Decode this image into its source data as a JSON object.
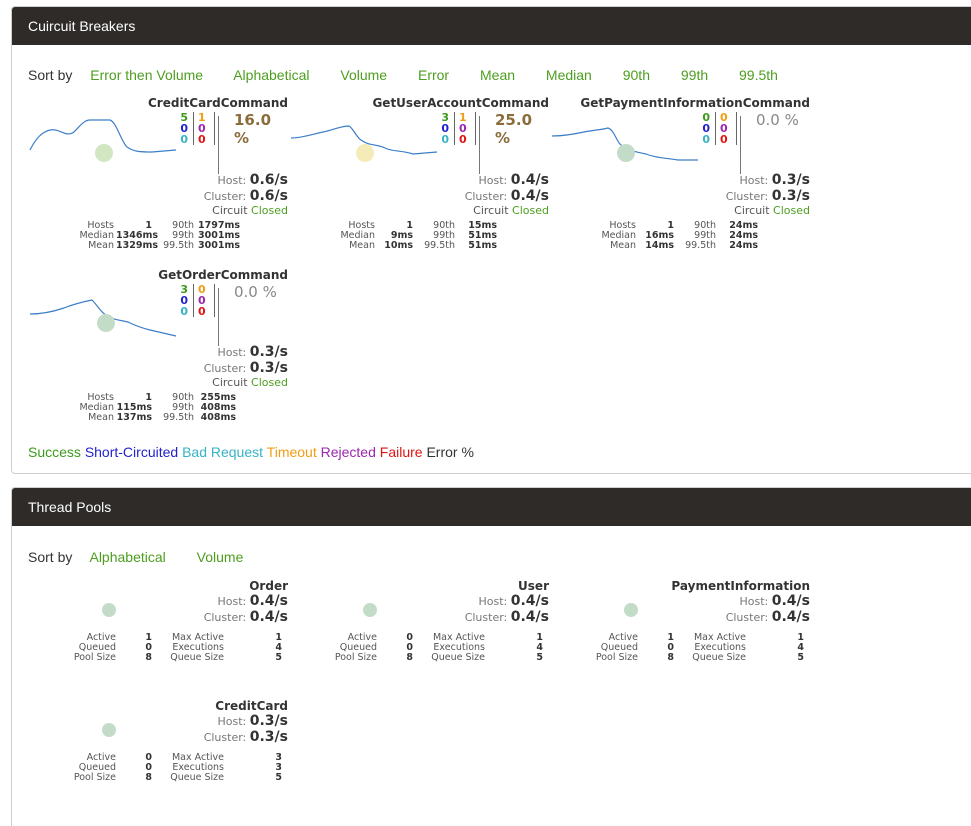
{
  "circuit_breakers": {
    "title": "Cuircuit Breakers",
    "sort_label": "Sort by",
    "sort_options": [
      "Error then Volume",
      "Alphabetical",
      "Volume",
      "Error",
      "Mean",
      "Median",
      "90th",
      "99th",
      "99.5th"
    ],
    "host_label": "Host:",
    "cluster_label": "Cluster:",
    "circuit_label": "Circuit",
    "stat_labels": {
      "hosts": "Hosts",
      "median": "Median",
      "mean": "Mean",
      "p90": "90th",
      "p99": "99th",
      "p995": "99.5th"
    },
    "commands": [
      {
        "name": "CreditCardCommand",
        "success": "5",
        "short_circuited": "0",
        "bad_request": "0",
        "timeout": "1",
        "rejected": "0",
        "failure": "0",
        "error_pct": "16.0 %",
        "host_rate": "0.6/s",
        "cluster_rate": "0.6/s",
        "circuit_status": "Closed",
        "hosts": "1",
        "median": "1346ms",
        "mean": "1329ms",
        "p90": "1797ms",
        "p99": "3001ms",
        "p995": "3001ms",
        "circle_color": "#d3e6c2"
      },
      {
        "name": "GetUserAccountCommand",
        "success": "3",
        "short_circuited": "0",
        "bad_request": "0",
        "timeout": "1",
        "rejected": "0",
        "failure": "0",
        "error_pct": "25.0 %",
        "host_rate": "0.4/s",
        "cluster_rate": "0.4/s",
        "circuit_status": "Closed",
        "hosts": "1",
        "median": "9ms",
        "mean": "10ms",
        "p90": "15ms",
        "p99": "51ms",
        "p995": "51ms",
        "circle_color": "#f3ecb8"
      },
      {
        "name": "GetPaymentInformationCommand",
        "success": "0",
        "short_circuited": "0",
        "bad_request": "0",
        "timeout": "0",
        "rejected": "0",
        "failure": "0",
        "error_pct": "0.0 %",
        "host_rate": "0.3/s",
        "cluster_rate": "0.3/s",
        "circuit_status": "Closed",
        "hosts": "1",
        "median": "16ms",
        "mean": "14ms",
        "p90": "24ms",
        "p99": "24ms",
        "p995": "24ms",
        "circle_color": "#c3dcc7"
      },
      {
        "name": "GetOrderCommand",
        "success": "3",
        "short_circuited": "0",
        "bad_request": "0",
        "timeout": "0",
        "rejected": "0",
        "failure": "0",
        "error_pct": "0.0 %",
        "host_rate": "0.3/s",
        "cluster_rate": "0.3/s",
        "circuit_status": "Closed",
        "hosts": "1",
        "median": "115ms",
        "mean": "137ms",
        "p90": "255ms",
        "p99": "408ms",
        "p995": "408ms",
        "circle_color": "#c3dcc7"
      }
    ],
    "legend": [
      {
        "label": "Success",
        "color": "#3c9a1c"
      },
      {
        "label": "Short-Circuited",
        "color": "#2222cc"
      },
      {
        "label": "Bad Request",
        "color": "#36b3c4"
      },
      {
        "label": "Timeout",
        "color": "#f39c12"
      },
      {
        "label": "Rejected",
        "color": "#9b27af"
      },
      {
        "label": "Failure",
        "color": "#e01414"
      },
      {
        "label": "Error %",
        "color": "#333333"
      }
    ]
  },
  "thread_pools": {
    "title": "Thread Pools",
    "sort_label": "Sort by",
    "sort_options": [
      "Alphabetical",
      "Volume"
    ],
    "host_label": "Host:",
    "cluster_label": "Cluster:",
    "stat_labels": {
      "active": "Active",
      "queued": "Queued",
      "pool_size": "Pool Size",
      "max_active": "Max Active",
      "executions": "Executions",
      "queue_size": "Queue Size"
    },
    "pools": [
      {
        "name": "Order",
        "host_rate": "0.4/s",
        "cluster_rate": "0.4/s",
        "active": "1",
        "queued": "0",
        "pool_size": "8",
        "max_active": "1",
        "executions": "4",
        "queue_size": "5"
      },
      {
        "name": "User",
        "host_rate": "0.4/s",
        "cluster_rate": "0.4/s",
        "active": "0",
        "queued": "0",
        "pool_size": "8",
        "max_active": "1",
        "executions": "4",
        "queue_size": "5"
      },
      {
        "name": "PaymentInformation",
        "host_rate": "0.4/s",
        "cluster_rate": "0.4/s",
        "active": "1",
        "queued": "0",
        "pool_size": "8",
        "max_active": "1",
        "executions": "4",
        "queue_size": "5"
      },
      {
        "name": "CreditCard",
        "host_rate": "0.3/s",
        "cluster_rate": "0.3/s",
        "active": "0",
        "queued": "0",
        "pool_size": "8",
        "max_active": "3",
        "executions": "3",
        "queue_size": "5"
      }
    ]
  }
}
